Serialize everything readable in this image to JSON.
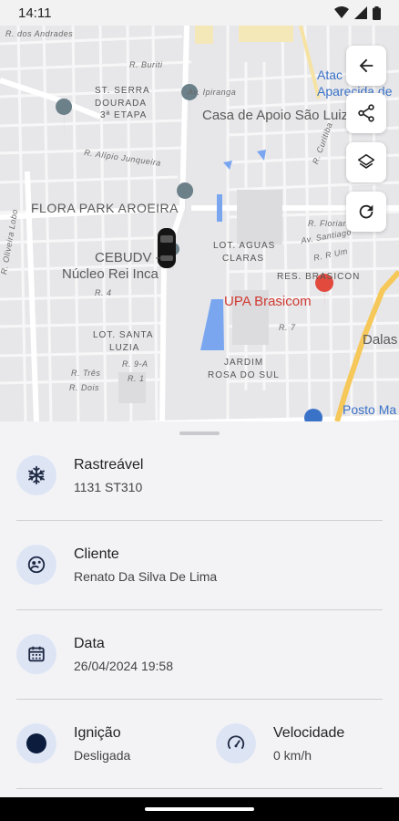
{
  "status": {
    "time": "14:11"
  },
  "map": {
    "labels": {
      "dos_andrades": "R. dos Andrades",
      "buriti": "R. Buriti",
      "ipiranga": "Av. Ipiranga",
      "st_serra_1": "ST. SERRA",
      "st_serra_2": "DOURADA",
      "st_serra_3": "3ª ETAPA",
      "casa_apoio": "Casa de Apoio São Luiz",
      "atacadao_1": "Atac",
      "atacadao_2": "Aparecida de",
      "alipio": "R. Alípio Junqueira",
      "curitiba": "R. Curitiba",
      "flora_park": "FLORA PARK AROEIRA",
      "cebudv_1": "CEBUDV -",
      "cebudv_2": "Núcleo Rei Inca",
      "lot_aguas_1": "LOT. AGUAS",
      "lot_aguas_2": "CLARAS",
      "florianopolis": "R. Florianóp",
      "santiago": "Av. Santiago",
      "r_um": "R. R Um",
      "res_brasicon": "RES. BRASICON",
      "oliveira_lobo": "R. Oliveira Lobo",
      "r4": "R. 4",
      "upa": "UPA Brasicom",
      "r7": "R. 7",
      "dalas": "Dalas",
      "santa_luzia_1": "LOT. SANTA",
      "santa_luzia_2": "LUZIA",
      "r9a": "R. 9-A",
      "tres": "R. Três",
      "r1": "R. 1",
      "dois": "R. Dois",
      "jardim_1": "JARDIM",
      "jardim_2": "ROSA DO SUL",
      "posto": "Posto Ma"
    },
    "buttons": [
      "back",
      "share",
      "layers",
      "refresh"
    ]
  },
  "details": {
    "rastreavel": {
      "title": "Rastreável",
      "value": "1131 ST310",
      "icon": "snowflake-icon"
    },
    "cliente": {
      "title": "Cliente",
      "value": "Renato Da Silva De Lima",
      "icon": "client-icon"
    },
    "data": {
      "title": "Data",
      "value": "26/04/2024 19:58",
      "icon": "calendar-icon"
    },
    "ignicao": {
      "title": "Ignição",
      "value": "Desligada",
      "icon": "ignition-status-icon"
    },
    "velocidade": {
      "title": "Velocidade",
      "value": "0 km/h",
      "icon": "speedometer-icon"
    }
  },
  "colors": {
    "accent_circle": "#dde5f5",
    "icon_dark": "#1f2a44",
    "ignition_off": "#0b1c3d",
    "map_bg": "#e6e6e8",
    "water": "#7aa6f0",
    "main_road": "#f6c85a"
  }
}
